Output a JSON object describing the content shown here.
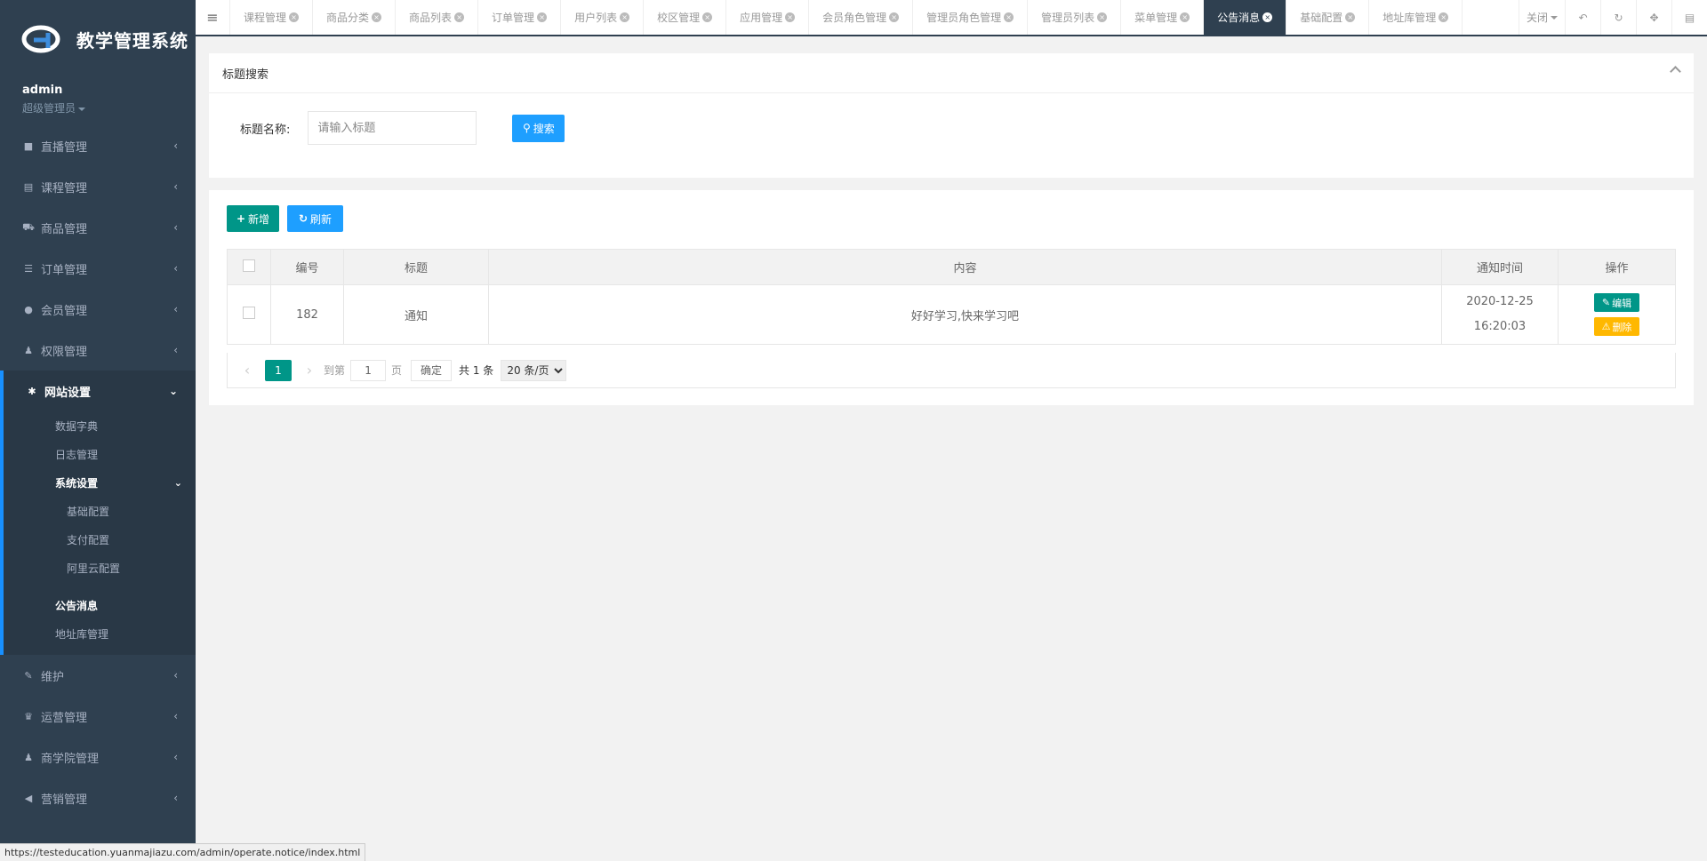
{
  "app": {
    "logo_text": "教学管理系统"
  },
  "user": {
    "name": "admin",
    "role": "超级管理员"
  },
  "sidebar": {
    "items": [
      {
        "label": "直播管理",
        "icon": "video-icon"
      },
      {
        "label": "课程管理",
        "icon": "book-icon"
      },
      {
        "label": "商品管理",
        "icon": "cart-icon"
      },
      {
        "label": "订单管理",
        "icon": "list-icon"
      },
      {
        "label": "会员管理",
        "icon": "user-icon"
      },
      {
        "label": "权限管理",
        "icon": "users-icon"
      }
    ],
    "open_group": {
      "label": "网站设置",
      "icon": "gear-icon",
      "children": [
        {
          "label": "数据字典"
        },
        {
          "label": "日志管理"
        },
        {
          "label": "系统设置",
          "children": [
            "基础配置",
            "支付配置",
            "阿里云配置"
          ]
        },
        {
          "label": "公告消息"
        },
        {
          "label": "地址库管理"
        }
      ]
    },
    "items_after": [
      {
        "label": "维护",
        "icon": "wand-icon"
      },
      {
        "label": "运营管理",
        "icon": "trophy-icon"
      },
      {
        "label": "商学院管理",
        "icon": "users-icon"
      },
      {
        "label": "营销管理",
        "icon": "bullhorn-icon"
      }
    ]
  },
  "tabs": [
    "课程管理",
    "商品分类",
    "商品列表",
    "订单管理",
    "用户列表",
    "校区管理",
    "应用管理",
    "会员角色管理",
    "管理员角色管理",
    "管理员列表",
    "菜单管理",
    "公告消息",
    "基础配置",
    "地址库管理"
  ],
  "active_tab": "公告消息",
  "tools": {
    "close_label": "关闭"
  },
  "search_panel": {
    "title": "标题搜索",
    "field_label": "标题名称:",
    "placeholder": "请输入标题",
    "search_label": "搜索"
  },
  "table_panel": {
    "add_label": "新增",
    "refresh_label": "刷新",
    "columns": [
      "编号",
      "标题",
      "内容",
      "通知时间",
      "操作"
    ],
    "rows": [
      {
        "id": "182",
        "title": "通知",
        "content": "好好学习,快来学习吧",
        "date": "2020-12-25",
        "time": "16:20:03",
        "edit_label": "编辑",
        "delete_label": "删除"
      }
    ]
  },
  "pager": {
    "current": "1",
    "goto_label": "到第",
    "goto_value": "1",
    "page_label": "页",
    "ok_label": "确定",
    "total_label": "共 1 条",
    "size_label": "20 条/页"
  },
  "status_url": "https://testeducation.yuanmajiazu.com/admin/operate.notice/index.html"
}
